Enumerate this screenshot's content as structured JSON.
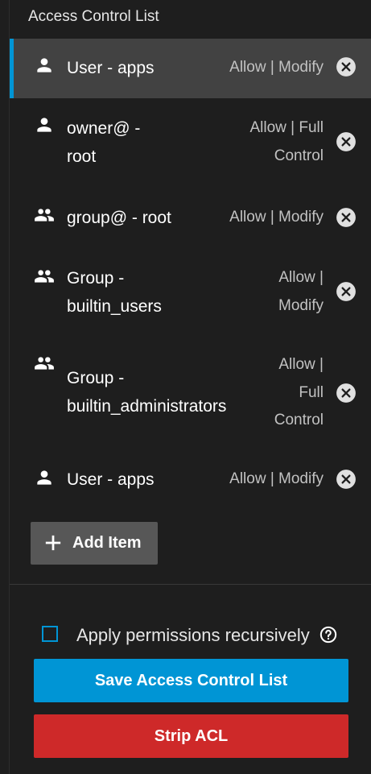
{
  "title": "Access Control List",
  "items": [
    {
      "who": [
        "User - apps"
      ],
      "perm": [
        "Allow | Modify"
      ],
      "type": "user-icon"
    },
    {
      "who": [
        "owner@ -",
        "root"
      ],
      "perm": [
        "Allow | Full",
        "Control"
      ],
      "type": "user-icon"
    },
    {
      "who": [
        "group@ - root"
      ],
      "perm": [
        "Allow | Modify"
      ],
      "type": "group-icon"
    },
    {
      "who": [
        "Group -",
        "builtin_users"
      ],
      "perm": [
        "Allow |",
        "Modify"
      ],
      "type": "group-icon"
    },
    {
      "who": [
        "Group -",
        "builtin_administrators"
      ],
      "perm": [
        "Allow |",
        "Full",
        "Control"
      ],
      "type": "group-icon"
    },
    {
      "who": [
        "User - apps"
      ],
      "perm": [
        "Allow | Modify"
      ],
      "type": "user-icon"
    }
  ],
  "add_item_label": "Add Item",
  "recursive_label": "Apply permissions recursively",
  "save_label": "Save Access Control List",
  "strip_label": "Strip ACL",
  "colors": {
    "accent": "#0095d5",
    "danger": "#ce2929",
    "selected_bg": "#424242"
  }
}
